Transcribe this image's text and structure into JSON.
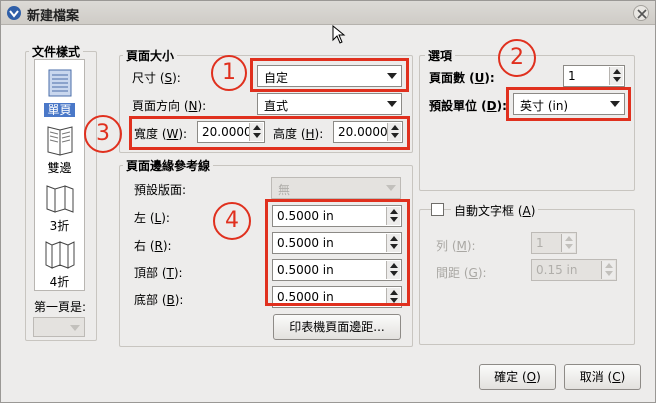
{
  "window": {
    "title": "新建檔案"
  },
  "doc_style": {
    "legend": "文件樣式",
    "items": [
      {
        "label": "單頁",
        "selected": true
      },
      {
        "label": "雙邊",
        "selected": false
      },
      {
        "label": "3折",
        "selected": false
      },
      {
        "label": "4折",
        "selected": false
      }
    ],
    "first_page_label": "第一頁是:"
  },
  "page_size": {
    "legend": "頁面大小",
    "size_label_pre": "尺寸 (",
    "size_label_key": "S",
    "size_label_post": "):",
    "size_value": "自定",
    "orient_label_pre": "頁面方向 (",
    "orient_label_key": "N",
    "orient_label_post": "):",
    "orient_value": "直式",
    "width_label_pre": "寬度 (",
    "width_label_key": "W",
    "width_label_post": "):",
    "width_value": "20.0000",
    "height_label_pre": "高度 (",
    "height_label_key": "H",
    "height_label_post": "):",
    "height_value": "20.0000"
  },
  "options": {
    "legend": "選項",
    "pages_label_pre": "頁面數 (",
    "pages_label_key": "U",
    "pages_label_post": "):",
    "pages_value": "1",
    "unit_label_pre": "預設單位 (",
    "unit_label_key": "D",
    "unit_label_post": "):",
    "unit_value": "英寸 (in)"
  },
  "margins": {
    "legend": "頁面邊緣參考線",
    "preset_label": "預設版面:",
    "preset_value": "無",
    "left_label_pre": "左 (",
    "left_label_key": "L",
    "left_label_post": "):",
    "left_value": "0.5000 in",
    "right_label_pre": "右 (",
    "right_label_key": "R",
    "right_label_post": "):",
    "right_value": "0.5000 in",
    "top_label_pre": "頂部 (",
    "top_label_key": "T",
    "top_label_post": "):",
    "top_value": "0.5000 in",
    "bottom_label_pre": "底部 (",
    "bottom_label_key": "B",
    "bottom_label_post": "):",
    "bottom_value": "0.5000 in",
    "printer_button": "印表機頁面邊距..."
  },
  "auto_frame": {
    "label_pre": "自動文字框 (",
    "label_key": "A",
    "label_post": ")",
    "columns_label_pre": "列 (",
    "columns_label_key": "M",
    "columns_label_post": "):",
    "columns_value": "1",
    "gap_label_pre": "間距 (",
    "gap_label_key": "G",
    "gap_label_post": "):",
    "gap_value": "0.15 in"
  },
  "buttons": {
    "ok_pre": "確定 (",
    "ok_key": "O",
    "ok_post": ")",
    "cancel_pre": "取消 (",
    "cancel_key": "C",
    "cancel_post": ")"
  },
  "annotations": {
    "n1": "1",
    "n2": "2",
    "n3": "3",
    "n4": "4"
  },
  "colors": {
    "highlight": "#e0301e",
    "selection": "#4a78c8"
  }
}
